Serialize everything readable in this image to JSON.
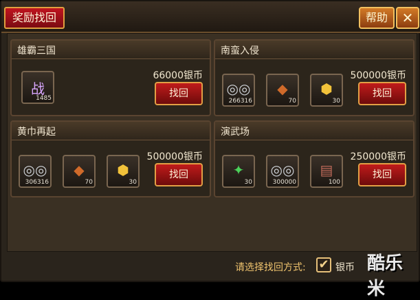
{
  "window": {
    "title": "奖励找回",
    "help_label": "帮助",
    "close_label": "✕"
  },
  "cards": [
    {
      "title": "雄霸三国",
      "price": "66000银币",
      "button_label": "找回",
      "items": [
        {
          "icon": "war-token-icon",
          "glyph": "战",
          "count": "1485"
        }
      ]
    },
    {
      "title": "南蛮入侵",
      "price": "500000银币",
      "button_label": "找回",
      "items": [
        {
          "icon": "silver-coins-icon",
          "glyph": "◎◎",
          "count": "266316"
        },
        {
          "icon": "fire-gem-icon",
          "glyph": "◆",
          "count": "70"
        },
        {
          "icon": "gold-hex-icon",
          "glyph": "⬢",
          "count": "30"
        }
      ]
    },
    {
      "title": "黄巾再起",
      "price": "500000银币",
      "button_label": "找回",
      "items": [
        {
          "icon": "silver-coins-icon",
          "glyph": "◎◎",
          "count": "306316"
        },
        {
          "icon": "fire-gem-icon",
          "glyph": "◆",
          "count": "70"
        },
        {
          "icon": "gold-hex-icon",
          "glyph": "⬢",
          "count": "30"
        }
      ]
    },
    {
      "title": "演武场",
      "price": "250000银币",
      "button_label": "找回",
      "items": [
        {
          "icon": "green-crystal-icon",
          "glyph": "✦",
          "count": "30"
        },
        {
          "icon": "silver-coins-icon",
          "glyph": "◎◎",
          "count": "300000"
        },
        {
          "icon": "scroll-token-icon",
          "glyph": "▤",
          "count": "100"
        }
      ]
    }
  ],
  "footer": {
    "prompt": "请选择找回方式:",
    "option_label": "银币",
    "option_checked": true
  },
  "watermark": {
    "text": "酷乐米"
  }
}
